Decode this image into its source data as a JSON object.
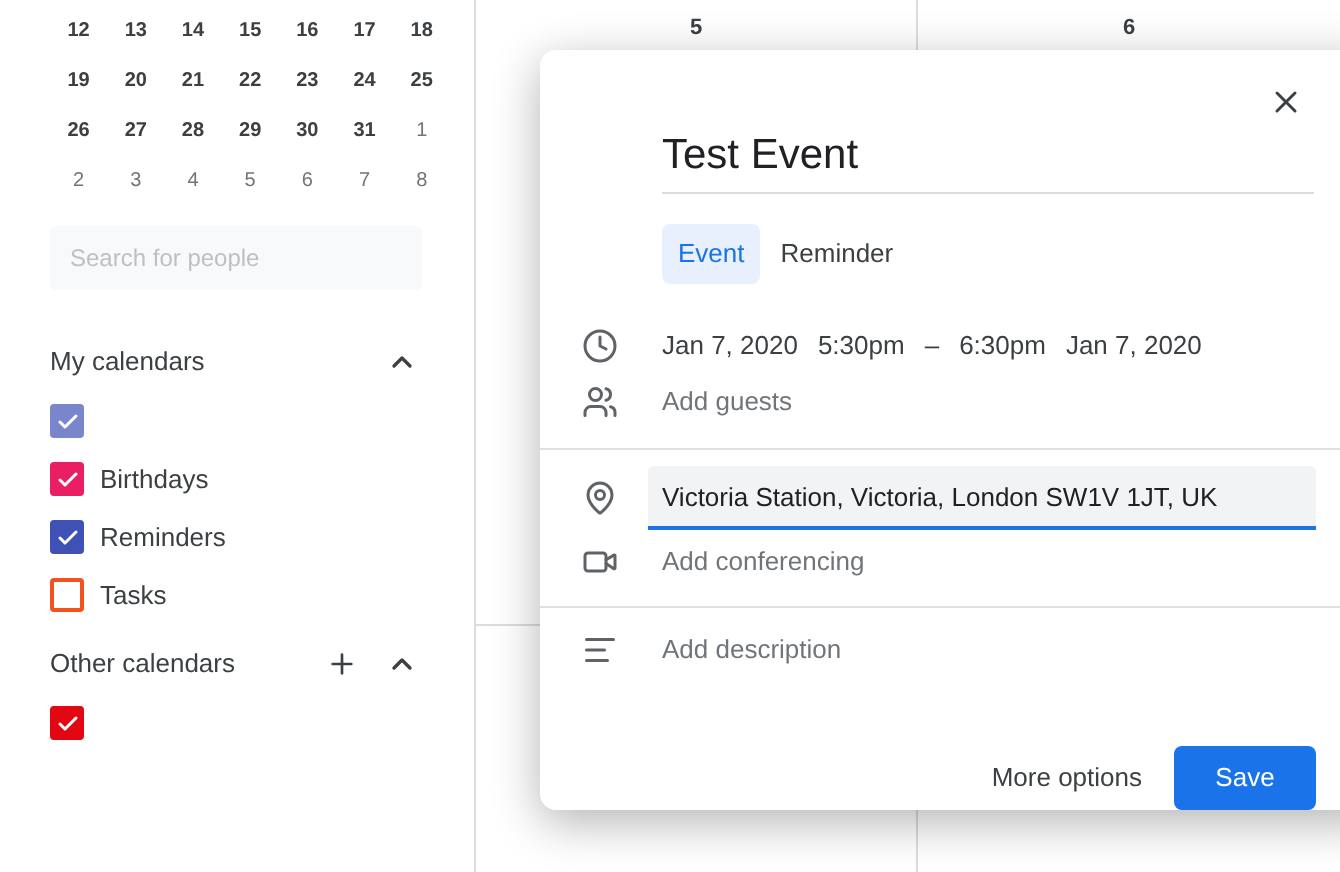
{
  "mini_calendar": {
    "weeks": [
      [
        {
          "day": "12",
          "muted": false
        },
        {
          "day": "13",
          "muted": false
        },
        {
          "day": "14",
          "muted": false
        },
        {
          "day": "15",
          "muted": false
        },
        {
          "day": "16",
          "muted": false
        },
        {
          "day": "17",
          "muted": false
        },
        {
          "day": "18",
          "muted": false
        }
      ],
      [
        {
          "day": "19",
          "muted": false
        },
        {
          "day": "20",
          "muted": false
        },
        {
          "day": "21",
          "muted": false
        },
        {
          "day": "22",
          "muted": false
        },
        {
          "day": "23",
          "muted": false
        },
        {
          "day": "24",
          "muted": false
        },
        {
          "day": "25",
          "muted": false
        }
      ],
      [
        {
          "day": "26",
          "muted": false
        },
        {
          "day": "27",
          "muted": false
        },
        {
          "day": "28",
          "muted": false
        },
        {
          "day": "29",
          "muted": false
        },
        {
          "day": "30",
          "muted": false
        },
        {
          "day": "31",
          "muted": false
        },
        {
          "day": "1",
          "muted": true
        }
      ],
      [
        {
          "day": "2",
          "muted": true
        },
        {
          "day": "3",
          "muted": true
        },
        {
          "day": "4",
          "muted": true
        },
        {
          "day": "5",
          "muted": true
        },
        {
          "day": "6",
          "muted": true
        },
        {
          "day": "7",
          "muted": true
        },
        {
          "day": "8",
          "muted": true
        }
      ]
    ]
  },
  "people_search": {
    "placeholder": "Search for people"
  },
  "my_calendars": {
    "title": "My calendars",
    "expanded": true,
    "items": [
      {
        "checked": true,
        "color": "#7986cb"
      },
      {
        "label": "Birthdays",
        "checked": true,
        "color": "#e91e63"
      },
      {
        "label": "Reminders",
        "checked": true,
        "color": "#3f51b5"
      },
      {
        "label": "Tasks",
        "checked": false,
        "color": "#f4511e"
      }
    ]
  },
  "other_calendars": {
    "title": "Other calendars",
    "expanded": true,
    "items": [
      {
        "checked": true,
        "color": "#e30613"
      }
    ]
  },
  "day_headers": [
    "5",
    "6"
  ],
  "dialog": {
    "title": "Test Event",
    "tabs": [
      {
        "label": "Event",
        "selected": true
      },
      {
        "label": "Reminder",
        "selected": false
      }
    ],
    "datetime": [
      "Jan 7, 2020",
      "5:30pm",
      "–",
      "6:30pm",
      "Jan 7, 2020"
    ],
    "guests": "Add guests",
    "location": "Victoria Station, Victoria, London SW1V 1JT, UK",
    "conferencing": "Add conferencing",
    "description": "Add description",
    "buttons": {
      "secondary": "More options",
      "primary": "Save"
    }
  }
}
